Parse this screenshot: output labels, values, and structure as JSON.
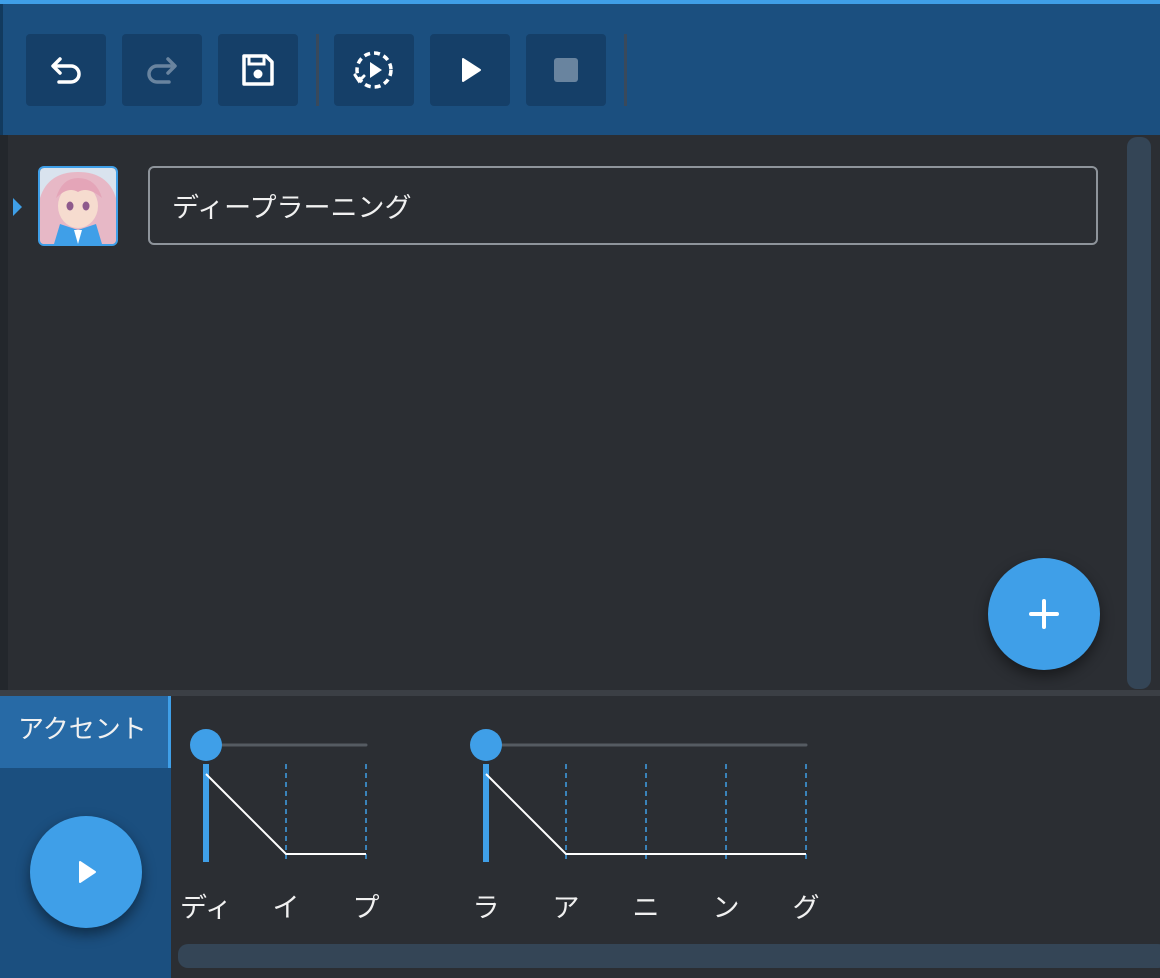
{
  "toolbar": {
    "buttons": [
      {
        "name": "undo-button",
        "icon": "undo-icon",
        "enabled": true
      },
      {
        "name": "redo-button",
        "icon": "redo-icon",
        "enabled": false
      },
      {
        "name": "save-button",
        "icon": "save-icon",
        "enabled": true
      },
      {
        "name": "play-continuous-button",
        "icon": "continuous-play-icon",
        "enabled": true
      },
      {
        "name": "play-button",
        "icon": "play-icon",
        "enabled": true
      },
      {
        "name": "stop-button",
        "icon": "stop-icon",
        "enabled": false
      }
    ]
  },
  "editor": {
    "rows": [
      {
        "speaker_avatar": "anime-girl-avatar",
        "text": "ディープラーニング",
        "selected": true
      }
    ],
    "add_button_icon": "plus-icon"
  },
  "bottom": {
    "tab_label": "アクセント",
    "play_button_icon": "play-icon",
    "phrases": [
      {
        "moras": [
          "ディ",
          "イ",
          "プ"
        ],
        "accent_position": 1
      },
      {
        "moras": [
          "ラ",
          "ア",
          "ニ",
          "ン",
          "グ"
        ],
        "accent_position": 1
      }
    ]
  },
  "colors": {
    "accent": "#3f9fe8",
    "toolbar_bg": "#1b4f7f",
    "button_bg": "#153f68",
    "editor_bg": "#2b2e33"
  }
}
